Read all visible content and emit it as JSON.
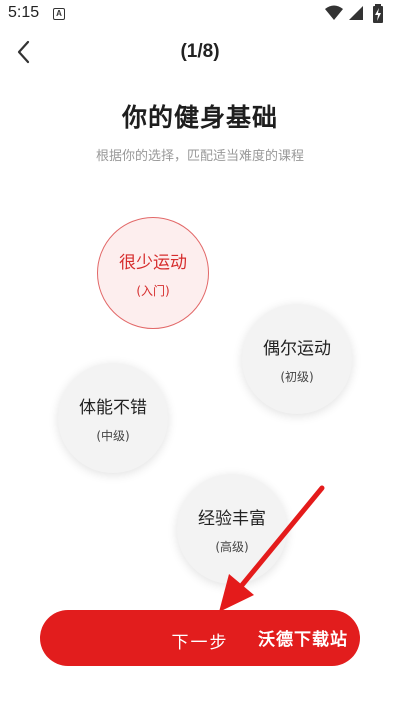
{
  "status_bar": {
    "time": "5:15",
    "notification_icon": "A",
    "icons": [
      "wifi-icon",
      "signal-icon",
      "battery-charging-icon"
    ]
  },
  "header": {
    "back_icon": "chevron-left-icon",
    "step": "(1/8)"
  },
  "page": {
    "title": "你的健身基础",
    "subtitle": "根据你的选择，匹配适当难度的课程"
  },
  "options": [
    {
      "label": "很少运动",
      "level": "(入门)",
      "selected": true
    },
    {
      "label": "偶尔运动",
      "level": "(初级)",
      "selected": false
    },
    {
      "label": "体能不错",
      "level": "(中级)",
      "selected": false
    },
    {
      "label": "经验丰富",
      "level": "(高级)",
      "selected": false
    }
  ],
  "next_button": {
    "label": "下一步"
  },
  "watermark": "沃德下载站",
  "colors": {
    "accent": "#e21d1d",
    "selected_text": "#d62d2d",
    "selected_border": "#e26868",
    "selected_bg": "#fdeeee",
    "bubble_bg": "#f3f3f3",
    "subtitle": "#999999"
  }
}
